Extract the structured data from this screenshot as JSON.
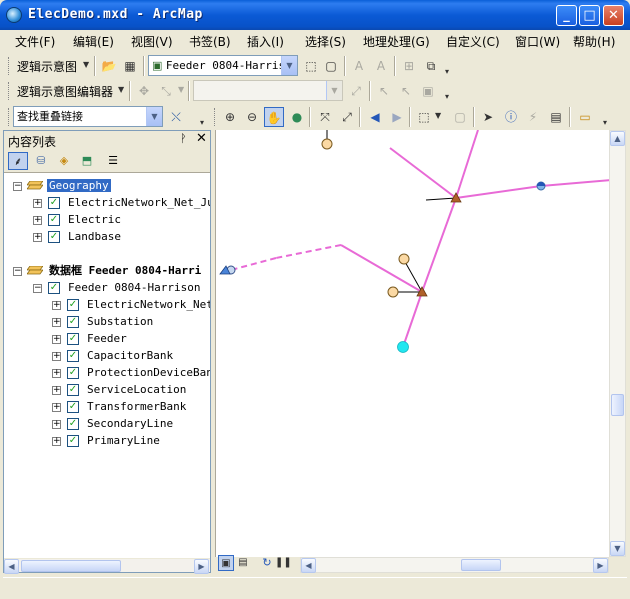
{
  "window": {
    "title": "ElecDemo.mxd - ArcMap",
    "minimize_label": "_",
    "maximize_label": "□",
    "close_label": "✕"
  },
  "menu": {
    "items": [
      {
        "label": "文件(F)"
      },
      {
        "label": "编辑(E)"
      },
      {
        "label": "视图(V)"
      },
      {
        "label": "书签(B)"
      },
      {
        "label": "插入(I)"
      },
      {
        "label": "选择(S)"
      },
      {
        "label": "地理处理(G)"
      },
      {
        "label": "自定义(C)"
      },
      {
        "label": "窗口(W)"
      },
      {
        "label": "帮助(H)"
      }
    ]
  },
  "toolbar1": {
    "schematic_menu_label": "逻辑示意图",
    "diagram_dropdown_value": "Feeder 0804-Harris"
  },
  "toolbar2": {
    "schematic_editor_label": "逻辑示意图编辑器",
    "layout_dropdown_value": ""
  },
  "toolbar3": {
    "overlap_dropdown_value": "查找重叠链接"
  },
  "toc": {
    "title": "内容列表",
    "pin_icon": "pin-icon",
    "close_label": "✕",
    "tree": [
      {
        "level": 0,
        "type": "frame",
        "label": "Geography",
        "selected": true
      },
      {
        "level": 1,
        "type": "layer",
        "label": "ElectricNetwork_Net_Jun",
        "checked": true
      },
      {
        "level": 1,
        "type": "layer",
        "label": "Electric",
        "checked": true
      },
      {
        "level": 1,
        "type": "layer",
        "label": "Landbase",
        "checked": true
      },
      {
        "level": 0,
        "type": "frame",
        "label": "数据框 Feeder 0804-Harri",
        "selected": false
      },
      {
        "level": 1,
        "type": "layer",
        "label": "Feeder 0804-Harrison",
        "checked": true
      },
      {
        "level": 2,
        "type": "layer",
        "label": "ElectricNetwork_Net_",
        "checked": true
      },
      {
        "level": 2,
        "type": "layer",
        "label": "Substation",
        "checked": true
      },
      {
        "level": 2,
        "type": "layer",
        "label": "Feeder",
        "checked": true
      },
      {
        "level": 2,
        "type": "layer",
        "label": "CapacitorBank",
        "checked": true
      },
      {
        "level": 2,
        "type": "layer",
        "label": "ProtectionDeviceBank",
        "checked": true
      },
      {
        "level": 2,
        "type": "layer",
        "label": "ServiceLocation",
        "checked": true
      },
      {
        "level": 2,
        "type": "layer",
        "label": "TransformerBank",
        "checked": true
      },
      {
        "level": 2,
        "type": "layer",
        "label": "SecondaryLine",
        "checked": true
      },
      {
        "level": 2,
        "type": "layer",
        "label": "PrimaryLine",
        "checked": true
      }
    ]
  },
  "map": {
    "primary_line_color": "#e86ad6",
    "secondary_line_color": "#000000",
    "transformer_color": "#b0602a",
    "service_location_color": "#fbd9a4",
    "feeder_source_color": "#22e6f0",
    "device_color": "#7fb4e8"
  }
}
